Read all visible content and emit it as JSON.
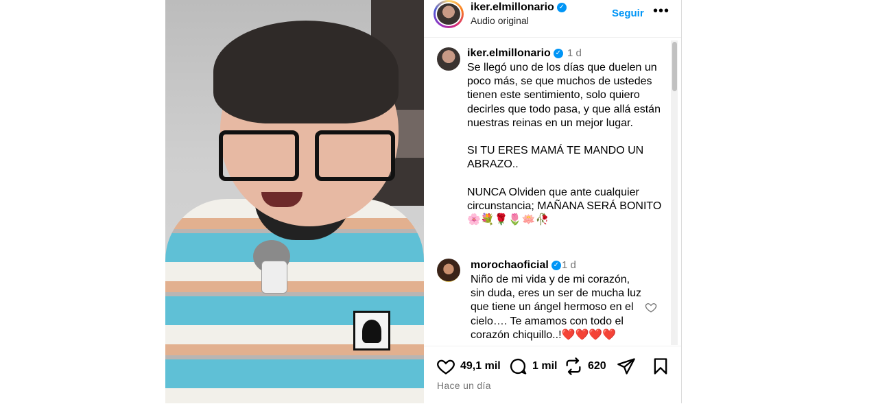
{
  "post": {
    "username": "iker.elmillonario",
    "subtitle": "Audio original",
    "follow_label": "Seguir",
    "more_label": "•••"
  },
  "caption": {
    "username": "iker.elmillonario",
    "time": "1 d",
    "text": "Se llegó uno de los días que duelen un poco más, se que muchos de ustedes tienen este sentimiento, solo quiero decirles que todo pasa, y que allá están nuestras reinas en un mejor lugar.\n\nSI TU ERES MAMÁ TE MANDO UN ABRAZO..\n\nNUNCA Olviden que ante cualquier circunstancia; MAÑANA SERÁ BONITO 🌸💐🌹🌷🪷🥀"
  },
  "comments": [
    {
      "username": "morochaoficial",
      "time": "1 d",
      "text": "Niño de mi vida y de mi corazón, sin duda, eres un ser de mucha luz que tiene un ángel hermoso en el cielo…. Te amamos con todo el corazón chiquillo..!❤️❤️❤️❤️"
    }
  ],
  "actions": {
    "likes": "49,1 mil",
    "comments": "1 mil",
    "reposts": "620",
    "time_ago": "Hace un día"
  },
  "icons": {
    "verified": "verified-badge-icon",
    "like": "heart-icon",
    "comment": "comment-bubble-icon",
    "repost": "repost-icon",
    "share": "share-paper-plane-icon",
    "save": "bookmark-icon"
  },
  "colors": {
    "accent": "#0095f6",
    "muted": "#737373"
  }
}
